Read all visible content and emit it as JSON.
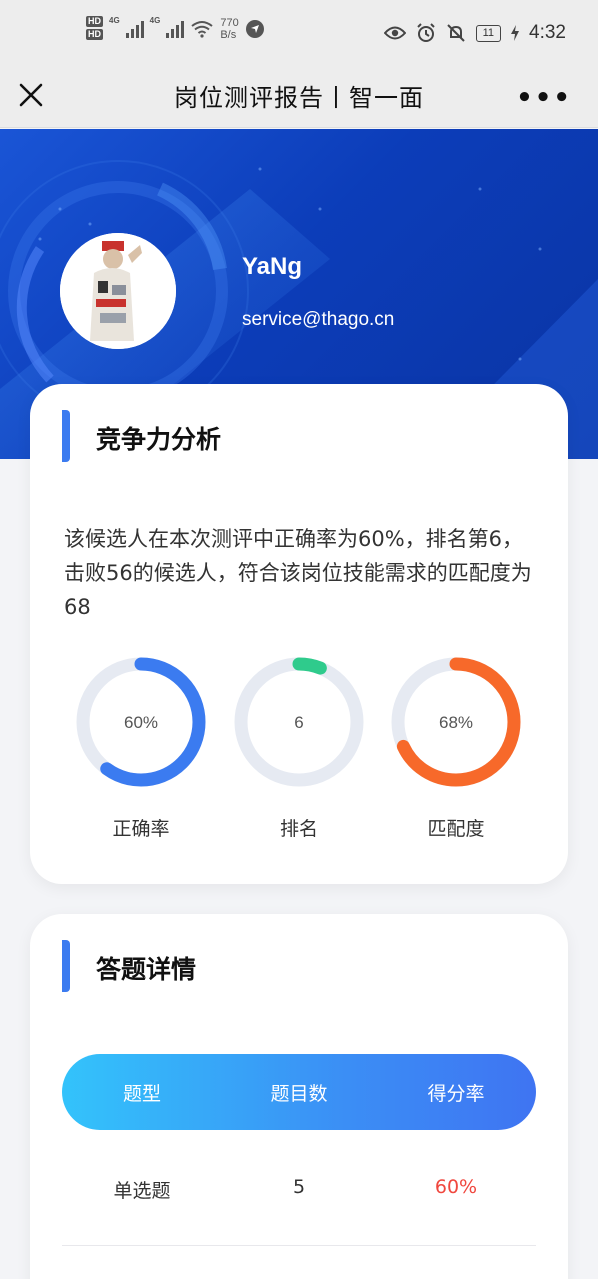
{
  "status_bar": {
    "speed_value": "770",
    "speed_unit": "B/s",
    "battery": "11",
    "time": "4:32"
  },
  "nav": {
    "title": "岗位测评报告丨智一面",
    "more": "•••"
  },
  "profile": {
    "name": "YaNg",
    "email": "service@thago.cn"
  },
  "competitiveness": {
    "title": "竞争力分析",
    "description": "该候选人在本次测评中正确率为60%，排名第6，击败56的候选人，符合该岗位技能需求的匹配度为68",
    "rings": [
      {
        "label": "正确率",
        "value": "60%",
        "fraction": 0.6,
        "color": "#3b7bf0"
      },
      {
        "label": "排名",
        "value": "6",
        "fraction": 0.06,
        "color": "#2fcb8c"
      },
      {
        "label": "匹配度",
        "value": "68%",
        "fraction": 0.68,
        "color": "#f7692a"
      }
    ]
  },
  "details": {
    "title": "答题详情",
    "headers": [
      "题型",
      "题目数",
      "得分率"
    ],
    "rows": [
      {
        "type": "单选题",
        "count": "5",
        "rate": "60%"
      }
    ]
  },
  "colors": {
    "brand_blue": "#0c3db9",
    "accent_blue": "#3b7bf0",
    "rate_red": "#f0473e"
  }
}
